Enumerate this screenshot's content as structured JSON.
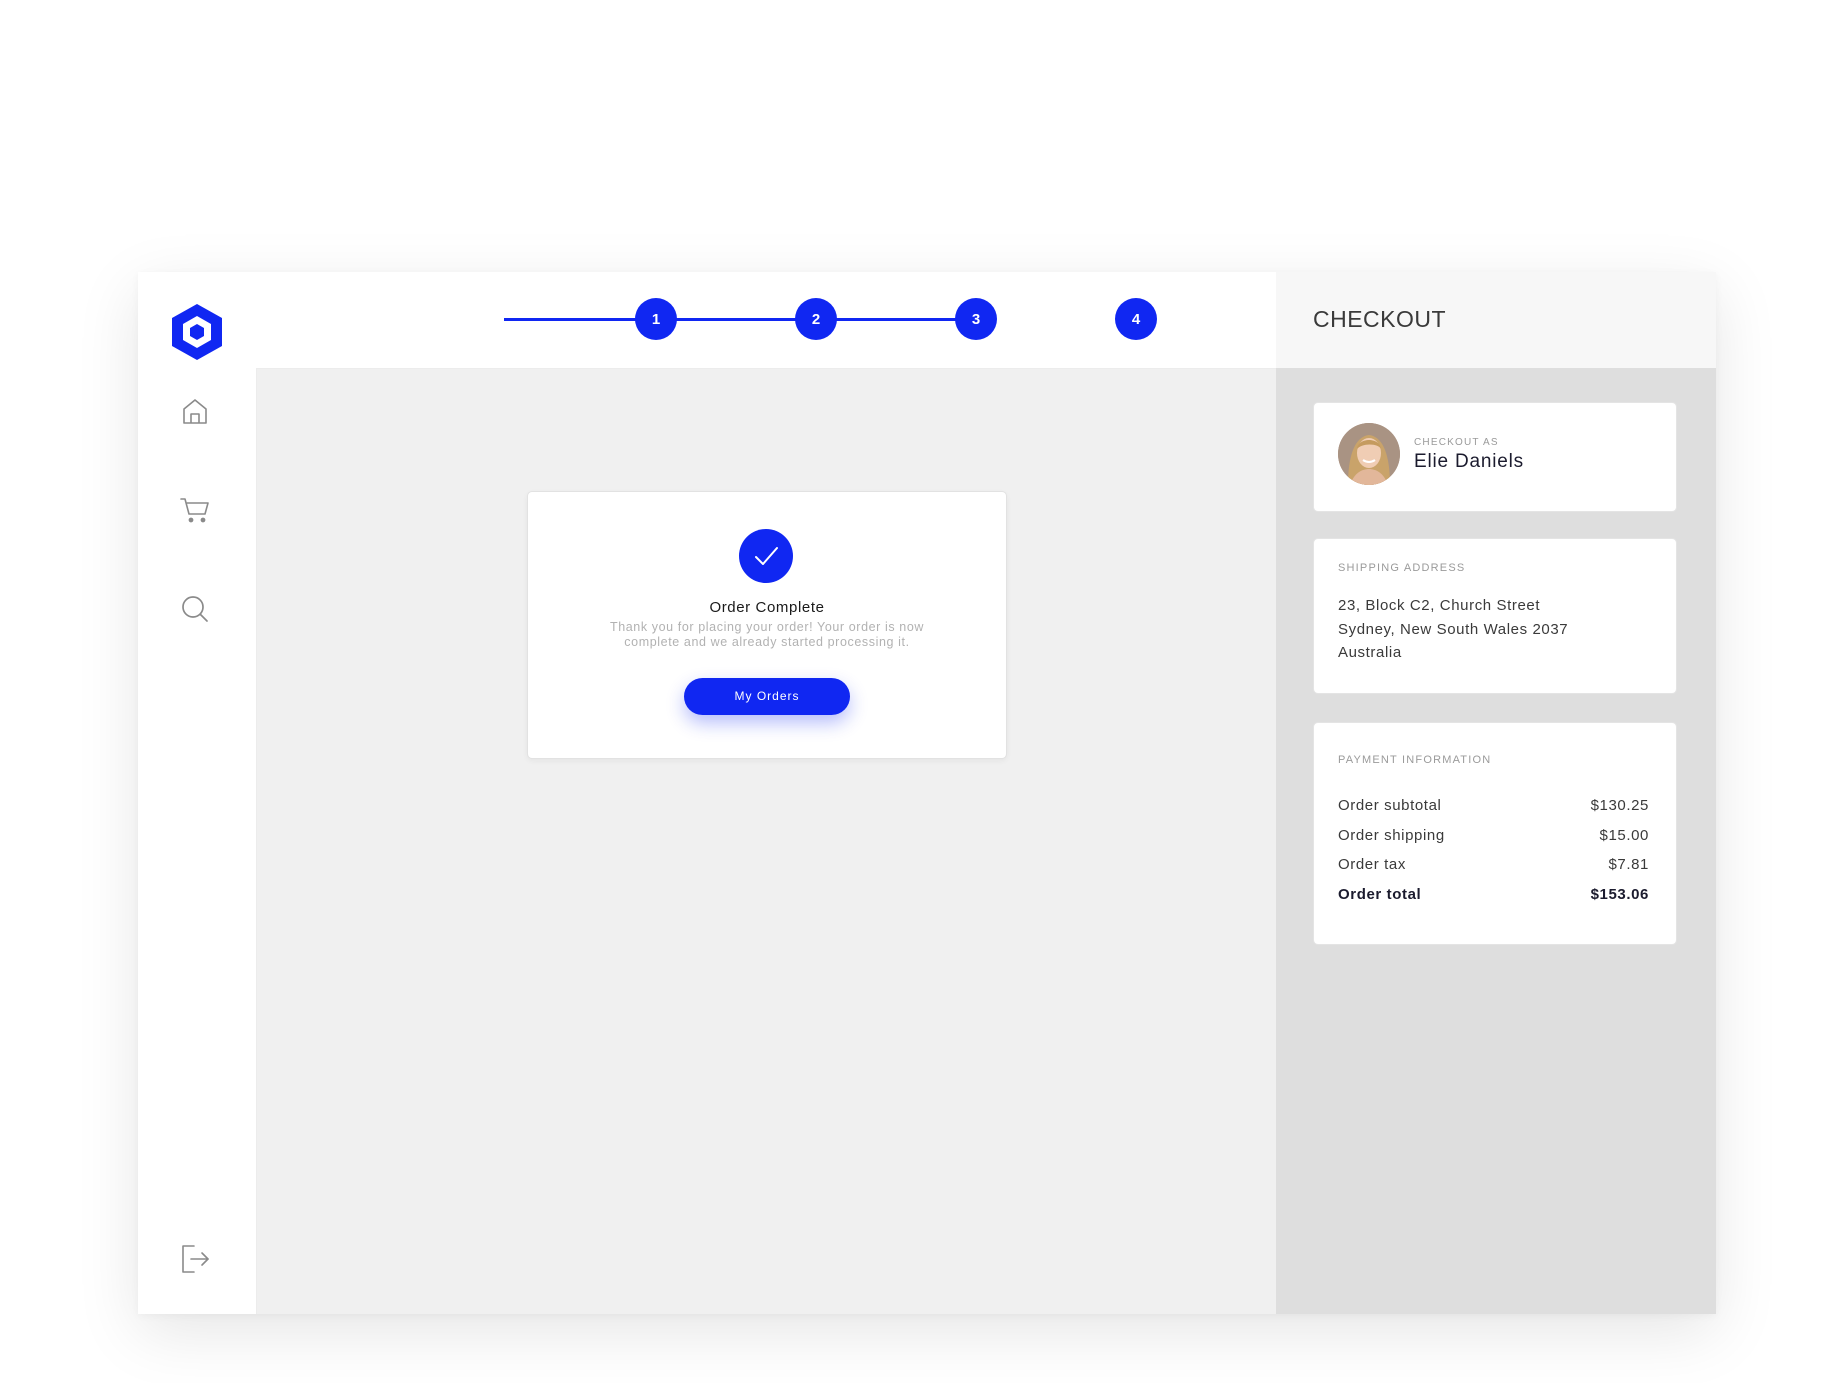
{
  "sidebar": {
    "logo": "hexagon-logo",
    "items": [
      {
        "icon": "home-icon"
      },
      {
        "icon": "cart-icon"
      },
      {
        "icon": "search-icon"
      }
    ],
    "logout_icon": "logout-icon"
  },
  "stepper": {
    "steps": [
      "1",
      "2",
      "3",
      "4"
    ],
    "color": "#1027f2"
  },
  "order": {
    "title": "Order Complete",
    "message": "Thank you for placing your order! Your order is now complete and we already started processing it.",
    "button_label": "My Orders"
  },
  "checkout": {
    "title": "CHECKOUT",
    "user": {
      "caption": "CHECKOUT AS",
      "name": "Elie Daniels"
    },
    "shipping": {
      "caption": "SHIPPING ADDRESS",
      "lines": [
        "23, Block C2, Church Street",
        "Sydney, New South Wales 2037",
        "Australia"
      ]
    },
    "payment": {
      "caption": "PAYMENT INFORMATION",
      "rows": [
        {
          "label": "Order subtotal",
          "value": "$130.25"
        },
        {
          "label": "Order shipping",
          "value": "$15.00"
        },
        {
          "label": "Order tax",
          "value": "$7.81"
        },
        {
          "label": "Order total",
          "value": "$153.06"
        }
      ]
    }
  },
  "colors": {
    "accent": "#1027f2",
    "background": "#f0f0f0",
    "panel": "#dedede"
  }
}
